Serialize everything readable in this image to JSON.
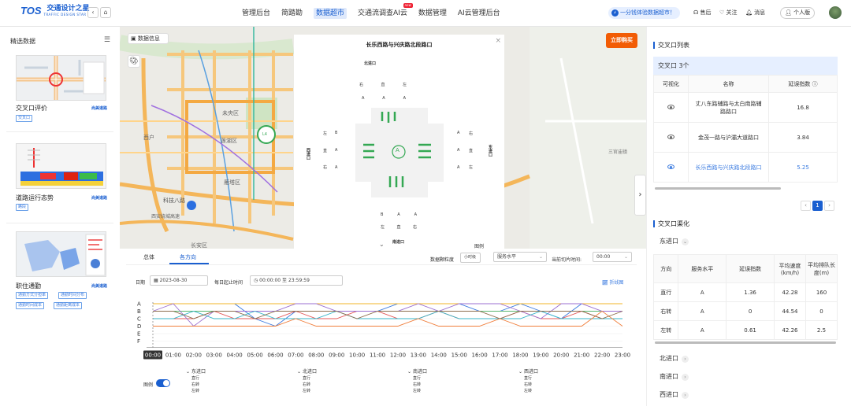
{
  "app": {
    "logo_mark": "TOS",
    "logo_cn": "交通设计之星",
    "logo_en": "TRAFFIC DESIGN STAR"
  },
  "nav": {
    "items": [
      {
        "label": "管理后台",
        "active": false
      },
      {
        "label": "简踏勘",
        "active": false
      },
      {
        "label": "数据超市",
        "active": true
      },
      {
        "label": "交通流调查AI云",
        "active": false,
        "badge": "new"
      },
      {
        "label": "数据管理",
        "active": false
      },
      {
        "label": "AI云管理后台",
        "active": false
      }
    ],
    "promo": "一分钱体验数据超市！",
    "help": "售后",
    "follow": "关注",
    "msg": "消息",
    "personal": "个人版"
  },
  "left": {
    "title": "精选数据",
    "cards": [
      {
        "title": "交叉口评价",
        "brand": "尚美道路",
        "tags": [
          "交叉口"
        ]
      },
      {
        "title": "道路运行态势",
        "brand": "尚美道路",
        "tags": [
          "路段"
        ]
      },
      {
        "title": "职住通勤",
        "brand": "尚美道路",
        "tags": [
          "通勤方式分担率",
          "通勤时间分布",
          "通勤时间成本",
          "通勤距离成本"
        ]
      }
    ]
  },
  "map": {
    "data_info": "数据信息",
    "buy": "立即购买",
    "labels": [
      "未央区",
      "莲湖区",
      "雁塔区",
      "科技八路",
      "长安区",
      "西安绕城高速",
      "三官庙镇",
      "西户"
    ],
    "marker": "L4"
  },
  "popup": {
    "title": "长乐西路与兴庆路北段路口",
    "north": "北进口",
    "south": "南进口",
    "west": "西进口",
    "east": "东进口",
    "center": "A",
    "legend": "图例",
    "row_north": [
      "右",
      "直",
      "左"
    ],
    "row_north_lv": [
      "A",
      "A",
      "A"
    ],
    "row_south_lv": [
      "B",
      "A",
      "A"
    ],
    "row_south": [
      "左",
      "直",
      "右"
    ],
    "row_west": [
      "左",
      "直",
      "右"
    ],
    "row_west_lv": [
      "B",
      "A",
      "A"
    ],
    "row_east": [
      "右",
      "直",
      "左"
    ],
    "row_east_lv": [
      "A",
      "A",
      "A"
    ]
  },
  "bottom": {
    "tabs": [
      "总体",
      "各方向"
    ],
    "active_tab": 1,
    "granularity_label": "数据颗粒度",
    "granularity_value": "小时级",
    "service_select": "服务水平",
    "slice_label": "当前切片时间:",
    "slice_value": "00:00",
    "date_label": "日期",
    "date_value": "2023-08-30",
    "period_label": "每日起止时间",
    "time_from": "00:00:00",
    "time_to": "23:59:59",
    "time_sep": "至",
    "chart_type": "折线图",
    "legend_label": "图例",
    "legend_groups": [
      {
        "title": "东进口",
        "items": [
          "直行",
          "右转",
          "左转"
        ]
      },
      {
        "title": "北进口",
        "items": [
          "直行",
          "右转",
          "左转"
        ]
      },
      {
        "title": "南进口",
        "items": [
          "直行",
          "右转",
          "左转"
        ]
      },
      {
        "title": "西进口",
        "items": [
          "直行",
          "右转",
          "左转"
        ]
      }
    ]
  },
  "chart_data": {
    "type": "line",
    "x": [
      "00:00",
      "01:00",
      "02:00",
      "03:00",
      "04:00",
      "05:00",
      "06:00",
      "07:00",
      "08:00",
      "09:00",
      "10:00",
      "11:00",
      "12:00",
      "13:00",
      "14:00",
      "15:00",
      "16:00",
      "17:00",
      "18:00",
      "19:00",
      "20:00",
      "21:00",
      "22:00",
      "23:00"
    ],
    "y_categories": [
      "A",
      "B",
      "C",
      "D",
      "E",
      "F"
    ],
    "series": [
      {
        "color": "#3b7be0",
        "values": [
          0,
          0,
          0,
          0,
          0,
          2,
          3,
          1,
          1,
          1,
          1,
          1,
          0,
          0,
          0,
          0,
          1,
          1,
          0,
          1,
          2,
          0,
          0,
          0
        ]
      },
      {
        "color": "#5ab46e",
        "values": [
          1,
          1,
          1,
          1,
          1,
          1,
          1,
          1,
          1,
          1,
          1,
          1,
          1,
          1,
          1,
          1,
          1,
          1,
          1,
          1,
          1,
          1,
          1,
          1
        ]
      },
      {
        "color": "#f0b429",
        "values": [
          0,
          0,
          0,
          0,
          0,
          0,
          0,
          0,
          0,
          0,
          0,
          0,
          0,
          0,
          0,
          0,
          0,
          0,
          0,
          0,
          0,
          0,
          0,
          0
        ]
      },
      {
        "color": "#e45858",
        "values": [
          2,
          2,
          2,
          1,
          2,
          2,
          2,
          1,
          2,
          2,
          1,
          1,
          2,
          2,
          1,
          2,
          2,
          2,
          1,
          2,
          2,
          1,
          2,
          2
        ]
      },
      {
        "color": "#9b6fd1",
        "values": [
          1,
          0,
          3,
          1,
          1,
          1,
          1,
          0,
          0,
          1,
          1,
          1,
          1,
          0,
          1,
          0,
          0,
          0,
          1,
          2,
          0,
          0,
          1,
          1
        ]
      },
      {
        "color": "#37b6c9",
        "values": [
          2,
          2,
          1,
          2,
          2,
          1,
          2,
          2,
          2,
          1,
          2,
          2,
          2,
          2,
          1,
          2,
          2,
          2,
          2,
          1,
          2,
          2,
          2,
          2
        ]
      },
      {
        "color": "#f07e3b",
        "values": [
          3,
          3,
          3,
          3,
          3,
          3,
          3,
          2,
          3,
          3,
          3,
          3,
          3,
          2,
          3,
          3,
          3,
          2,
          3,
          3,
          3,
          3,
          1,
          3
        ]
      },
      {
        "color": "#8d6e4e",
        "values": [
          1,
          1,
          2,
          1,
          1,
          2,
          1,
          1,
          1,
          1,
          2,
          1,
          1,
          1,
          1,
          1,
          1,
          2,
          1,
          1,
          1,
          1,
          2,
          1
        ]
      }
    ],
    "ylabel": "",
    "xlabel": ""
  },
  "right": {
    "list_title": "交叉口列表",
    "count_label": "交叉口 3个",
    "columns": [
      "可视化",
      "名称",
      "延误指数"
    ],
    "rows": [
      {
        "name": "丈八东路辅路与太白南路辅路路口",
        "index": "16.8",
        "active": false
      },
      {
        "name": "金茂一路与沪灞大道路口",
        "index": "3.84",
        "active": false
      },
      {
        "name": "长乐西路与兴庆路北段路口",
        "index": "5.25",
        "active": true
      }
    ],
    "page": "1",
    "detail_title": "交叉口渠化",
    "approach": "东进口",
    "detail_columns": [
      "方向",
      "服务水平",
      "延误指数",
      "平均速度(km/h)",
      "平均排队长度(m)"
    ],
    "detail_rows": [
      [
        "直行",
        "A",
        "1.36",
        "42.28",
        "160"
      ],
      [
        "右转",
        "A",
        "0",
        "44.54",
        "0"
      ],
      [
        "左转",
        "A",
        "0.61",
        "42.26",
        "2.5"
      ]
    ],
    "other_approaches": [
      "北进口",
      "南进口",
      "西进口"
    ]
  }
}
